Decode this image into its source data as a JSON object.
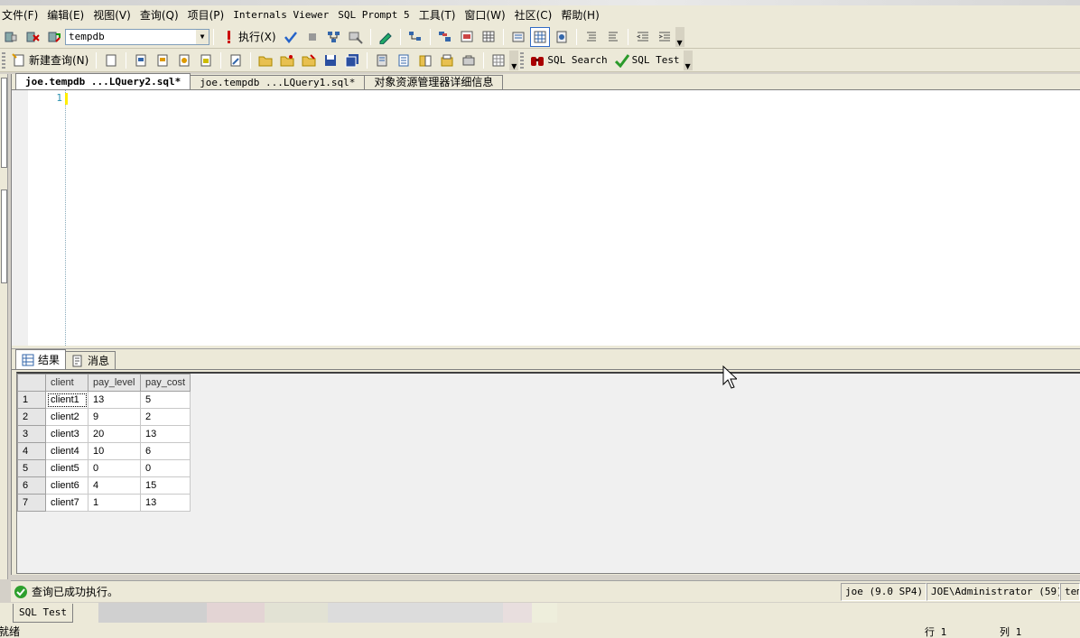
{
  "menu": [
    {
      "label": "文件(F)"
    },
    {
      "label": "编辑(E)"
    },
    {
      "label": "视图(V)"
    },
    {
      "label": "查询(Q)"
    },
    {
      "label": "项目(P)"
    },
    {
      "label": "Internals Viewer"
    },
    {
      "label": "SQL Prompt 5"
    },
    {
      "label": "工具(T)"
    },
    {
      "label": "窗口(W)"
    },
    {
      "label": "社区(C)"
    },
    {
      "label": "帮助(H)"
    }
  ],
  "toolbar1": {
    "database": "tempdb",
    "execute_label": "执行(X)",
    "icons": [
      "connect-icon",
      "disconnect-icon",
      "change-connection-icon",
      "execute-icon",
      "parse-icon",
      "cancel-icon",
      "estimated-plan-icon",
      "query-designer-icon",
      "intellisense-icon",
      "include-plan-icon",
      "client-stats-icon",
      "results-text-icon",
      "results-grid-icon",
      "results-file-icon",
      "comment-icon",
      "uncomment-icon",
      "decrease-indent-icon",
      "increase-indent-icon"
    ]
  },
  "toolbar2": {
    "new_query_label": "新建查询(N)",
    "sql_search_label": "SQL Search",
    "sql_test_label": "SQL Test"
  },
  "doc_tabs": [
    {
      "label": "joe.tempdb ...LQuery2.sql*",
      "active": true
    },
    {
      "label": "joe.tempdb ...LQuery1.sql*",
      "active": false
    },
    {
      "label": "对象资源管理器详细信息",
      "active": false
    }
  ],
  "editor": {
    "line_number": "1"
  },
  "result_tabs": [
    {
      "label": "结果",
      "active": true,
      "icon": "grid-icon"
    },
    {
      "label": "消息",
      "active": false,
      "icon": "message-icon"
    }
  ],
  "results": {
    "columns": [
      "client",
      "pay_level",
      "pay_cost"
    ],
    "rows": [
      {
        "n": "1",
        "client": "client1",
        "pay_level": "13",
        "pay_cost": "5"
      },
      {
        "n": "2",
        "client": "client2",
        "pay_level": "9",
        "pay_cost": "2"
      },
      {
        "n": "3",
        "client": "client3",
        "pay_level": "20",
        "pay_cost": "13"
      },
      {
        "n": "4",
        "client": "client4",
        "pay_level": "10",
        "pay_cost": "6"
      },
      {
        "n": "5",
        "client": "client5",
        "pay_level": "0",
        "pay_cost": "0"
      },
      {
        "n": "6",
        "client": "client6",
        "pay_level": "4",
        "pay_cost": "15"
      },
      {
        "n": "7",
        "client": "client7",
        "pay_level": "1",
        "pay_cost": "13"
      }
    ]
  },
  "query_status": {
    "message": "查询已成功执行。",
    "server": "joe (9.0 SP4)",
    "user": "JOE\\Administrator (59)",
    "db": "tem"
  },
  "bottom_tab": "SQL Test",
  "app_status": {
    "ready": "就绪",
    "line": "行 1",
    "col": "列 1"
  },
  "colors": {
    "chrome": "#ece9d8",
    "success": "#2ea02e",
    "line_number": "#2b91af"
  }
}
